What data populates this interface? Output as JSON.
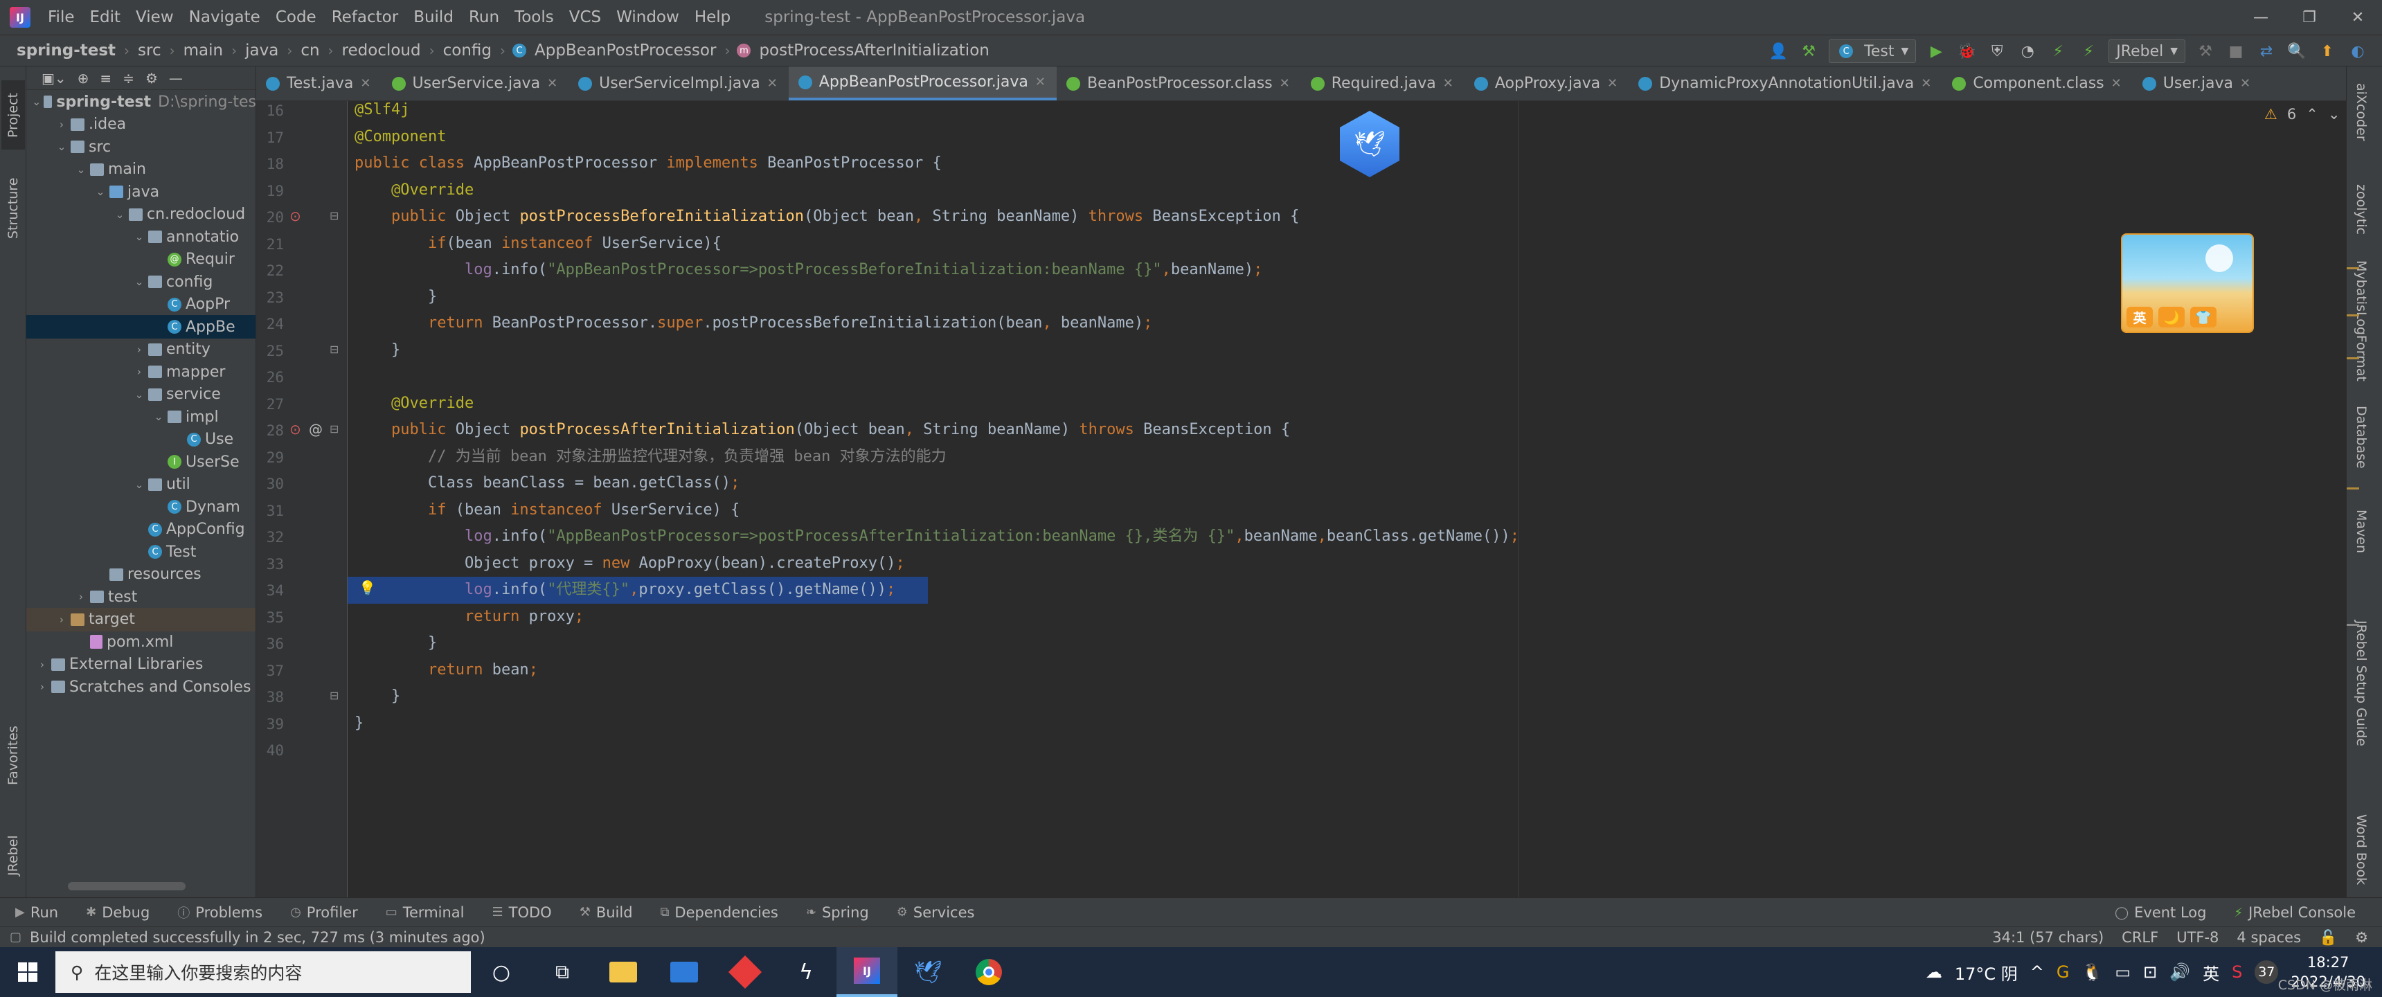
{
  "menubar": {
    "items": [
      "File",
      "Edit",
      "View",
      "Navigate",
      "Code",
      "Refactor",
      "Build",
      "Run",
      "Tools",
      "VCS",
      "Window",
      "Help"
    ],
    "window_title": "spring-test - AppBeanPostProcessor.java"
  },
  "navbar": {
    "crumbs": [
      "spring-test",
      "src",
      "main",
      "java",
      "cn",
      "redocloud",
      "config",
      "AppBeanPostProcessor",
      "postProcessAfterInitialization"
    ],
    "run_config": "Test",
    "jrebel": "JRebel"
  },
  "left_strip": {
    "project": "Project",
    "structure": "Structure",
    "favorites": "Favorites",
    "jrebel": "JRebel"
  },
  "project_tree": [
    {
      "label": "spring-test",
      "extra": "D:\\spring-tes",
      "depth": 0,
      "type": "module",
      "open": true
    },
    {
      "label": ".idea",
      "depth": 1,
      "type": "folder",
      "open": false
    },
    {
      "label": "src",
      "depth": 1,
      "type": "folder",
      "open": true
    },
    {
      "label": "main",
      "depth": 2,
      "type": "folder",
      "open": true
    },
    {
      "label": "java",
      "depth": 3,
      "type": "srcfolder",
      "open": true
    },
    {
      "label": "cn.redocloud",
      "depth": 4,
      "type": "folder",
      "open": true
    },
    {
      "label": "annotatio",
      "depth": 5,
      "type": "folder",
      "open": true
    },
    {
      "label": "Requir",
      "depth": 6,
      "type": "annotation"
    },
    {
      "label": "config",
      "depth": 5,
      "type": "folder",
      "open": true
    },
    {
      "label": "AopPr",
      "depth": 6,
      "type": "class"
    },
    {
      "label": "AppBe",
      "depth": 6,
      "type": "class",
      "selected": true
    },
    {
      "label": "entity",
      "depth": 5,
      "type": "folder",
      "open": false
    },
    {
      "label": "mapper",
      "depth": 5,
      "type": "folder",
      "open": false
    },
    {
      "label": "service",
      "depth": 5,
      "type": "folder",
      "open": true
    },
    {
      "label": "impl",
      "depth": 6,
      "type": "folder",
      "open": true
    },
    {
      "label": "Use",
      "depth": 7,
      "type": "class"
    },
    {
      "label": "UserSe",
      "depth": 6,
      "type": "interface"
    },
    {
      "label": "util",
      "depth": 5,
      "type": "folder",
      "open": true
    },
    {
      "label": "Dynam",
      "depth": 6,
      "type": "class"
    },
    {
      "label": "AppConfig",
      "depth": 5,
      "type": "class"
    },
    {
      "label": "Test",
      "depth": 5,
      "type": "class"
    },
    {
      "label": "resources",
      "depth": 3,
      "type": "folder"
    },
    {
      "label": "test",
      "depth": 2,
      "type": "folder",
      "open": false
    },
    {
      "label": "target",
      "depth": 1,
      "type": "target",
      "open": false
    },
    {
      "label": "pom.xml",
      "depth": 2,
      "type": "xml"
    },
    {
      "label": "External Libraries",
      "depth": 0,
      "type": "lib",
      "open": false
    },
    {
      "label": "Scratches and Consoles",
      "depth": 0,
      "type": "scratch",
      "open": false
    }
  ],
  "tabs": [
    {
      "label": "Test.java",
      "icon": "class"
    },
    {
      "label": "UserService.java",
      "icon": "interface"
    },
    {
      "label": "UserServiceImpl.java",
      "icon": "class"
    },
    {
      "label": "AppBeanPostProcessor.java",
      "icon": "class",
      "active": true
    },
    {
      "label": "BeanPostProcessor.class",
      "icon": "interface"
    },
    {
      "label": "Required.java",
      "icon": "annotation"
    },
    {
      "label": "AopProxy.java",
      "icon": "class"
    },
    {
      "label": "DynamicProxyAnnotationUtil.java",
      "icon": "class"
    },
    {
      "label": "Component.class",
      "icon": "annotation"
    },
    {
      "label": "User.java",
      "icon": "class"
    }
  ],
  "editor": {
    "line_numbers": [
      "16",
      "17",
      "18",
      "19",
      "20",
      "21",
      "22",
      "23",
      "24",
      "25",
      "26",
      "27",
      "28",
      "29",
      "30",
      "31",
      "32",
      "33",
      "34",
      "35",
      "36",
      "37",
      "38",
      "39",
      "40"
    ],
    "lines": [
      "@Slf4j",
      "@Component",
      "public class AppBeanPostProcessor implements BeanPostProcessor {",
      "    @Override",
      "    public Object postProcessBeforeInitialization(Object bean, String beanName) throws BeansException {",
      "        if(bean instanceof UserService){",
      "            log.info(\"AppBeanPostProcessor=>postProcessBeforeInitialization:beanName {}\",beanName);",
      "        }",
      "        return BeanPostProcessor.super.postProcessBeforeInitialization(bean, beanName);",
      "    }",
      "",
      "    @Override",
      "    public Object postProcessAfterInitialization(Object bean, String beanName) throws BeansException {",
      "        // 为当前 bean 对象注册监控代理对象，负责增强 bean 对象方法的能力",
      "        Class beanClass = bean.getClass();",
      "        if (bean instanceof UserService) {",
      "            log.info(\"AppBeanPostProcessor=>postProcessAfterInitialization:beanName {},类名为 {}\",beanName,beanClass.getName());",
      "            Object proxy = new AopProxy(bean).createProxy();",
      "            log.info(\"代理类{}\",proxy.getClass().getName());",
      "            return proxy;",
      "        }",
      "        return bean;",
      "    }",
      "}",
      ""
    ],
    "warnings_count": "6"
  },
  "right_strip": [
    "aiXcoder",
    "zoolytic",
    "MybatisLogFormat",
    "Database",
    "Maven",
    "JRebel Setup Guide",
    "Word Book"
  ],
  "beach_widget": {
    "buttons": [
      "英",
      "🌙",
      "👕"
    ]
  },
  "bottom_tools": [
    "Run",
    "Debug",
    "Problems",
    "Profiler",
    "Terminal",
    "TODO",
    "Build",
    "Dependencies",
    "Spring",
    "Services"
  ],
  "bottom_right_tools": [
    "Event Log",
    "JRebel Console"
  ],
  "status": {
    "message": "Build completed successfully in 2 sec, 727 ms (3 minutes ago)",
    "position": "34:1 (57 chars)",
    "line_sep": "CRLF",
    "encoding": "UTF-8",
    "indent": "4 spaces"
  },
  "taskbar": {
    "search_placeholder": "在这里输入你要搜索的内容",
    "weather": "17°C 阴",
    "ime": "英",
    "badge": "37",
    "time": "18:27",
    "date": "2022/4/30",
    "watermark": "CSDN @被雨淋"
  },
  "colors": {
    "accent": "#4a88c7",
    "selection": "#214283",
    "keyword": "#cc7832",
    "string": "#6a8759",
    "annotation": "#bbb529",
    "method": "#ffc66d"
  }
}
